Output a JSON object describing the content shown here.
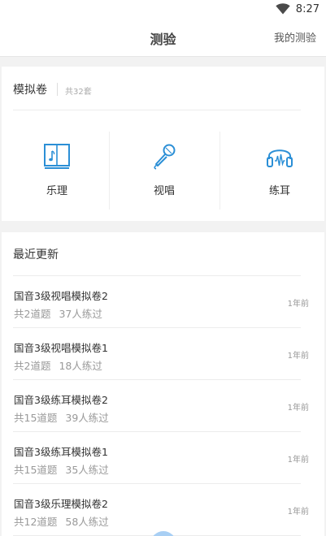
{
  "status_bar": {
    "time": "8:27",
    "icons": [
      "wifi-icon"
    ]
  },
  "header": {
    "title": "测验",
    "right_link": "我的测验"
  },
  "mock_exams": {
    "title": "模拟卷",
    "count_label": "共32套",
    "categories": [
      {
        "label": "乐理",
        "icon": "music-book-icon"
      },
      {
        "label": "视唱",
        "icon": "microphone-icon"
      },
      {
        "label": "练耳",
        "icon": "headphones-icon"
      }
    ],
    "accent_color": "#2b8fd6"
  },
  "recent": {
    "title": "最近更新",
    "items": [
      {
        "name": "国音3级视唱模拟卷2",
        "questions": "共2道题",
        "takers": "37人练过",
        "ago": "1年前"
      },
      {
        "name": "国音3级视唱模拟卷1",
        "questions": "共2道题",
        "takers": "18人练过",
        "ago": "1年前"
      },
      {
        "name": "国音3级练耳模拟卷2",
        "questions": "共15道题",
        "takers": "39人练过",
        "ago": "1年前"
      },
      {
        "name": "国音3级练耳模拟卷1",
        "questions": "共15道题",
        "takers": "35人练过",
        "ago": "1年前"
      },
      {
        "name": "国音3级乐理模拟卷2",
        "questions": "共12道题",
        "takers": "58人练过",
        "ago": "1年前"
      }
    ]
  }
}
